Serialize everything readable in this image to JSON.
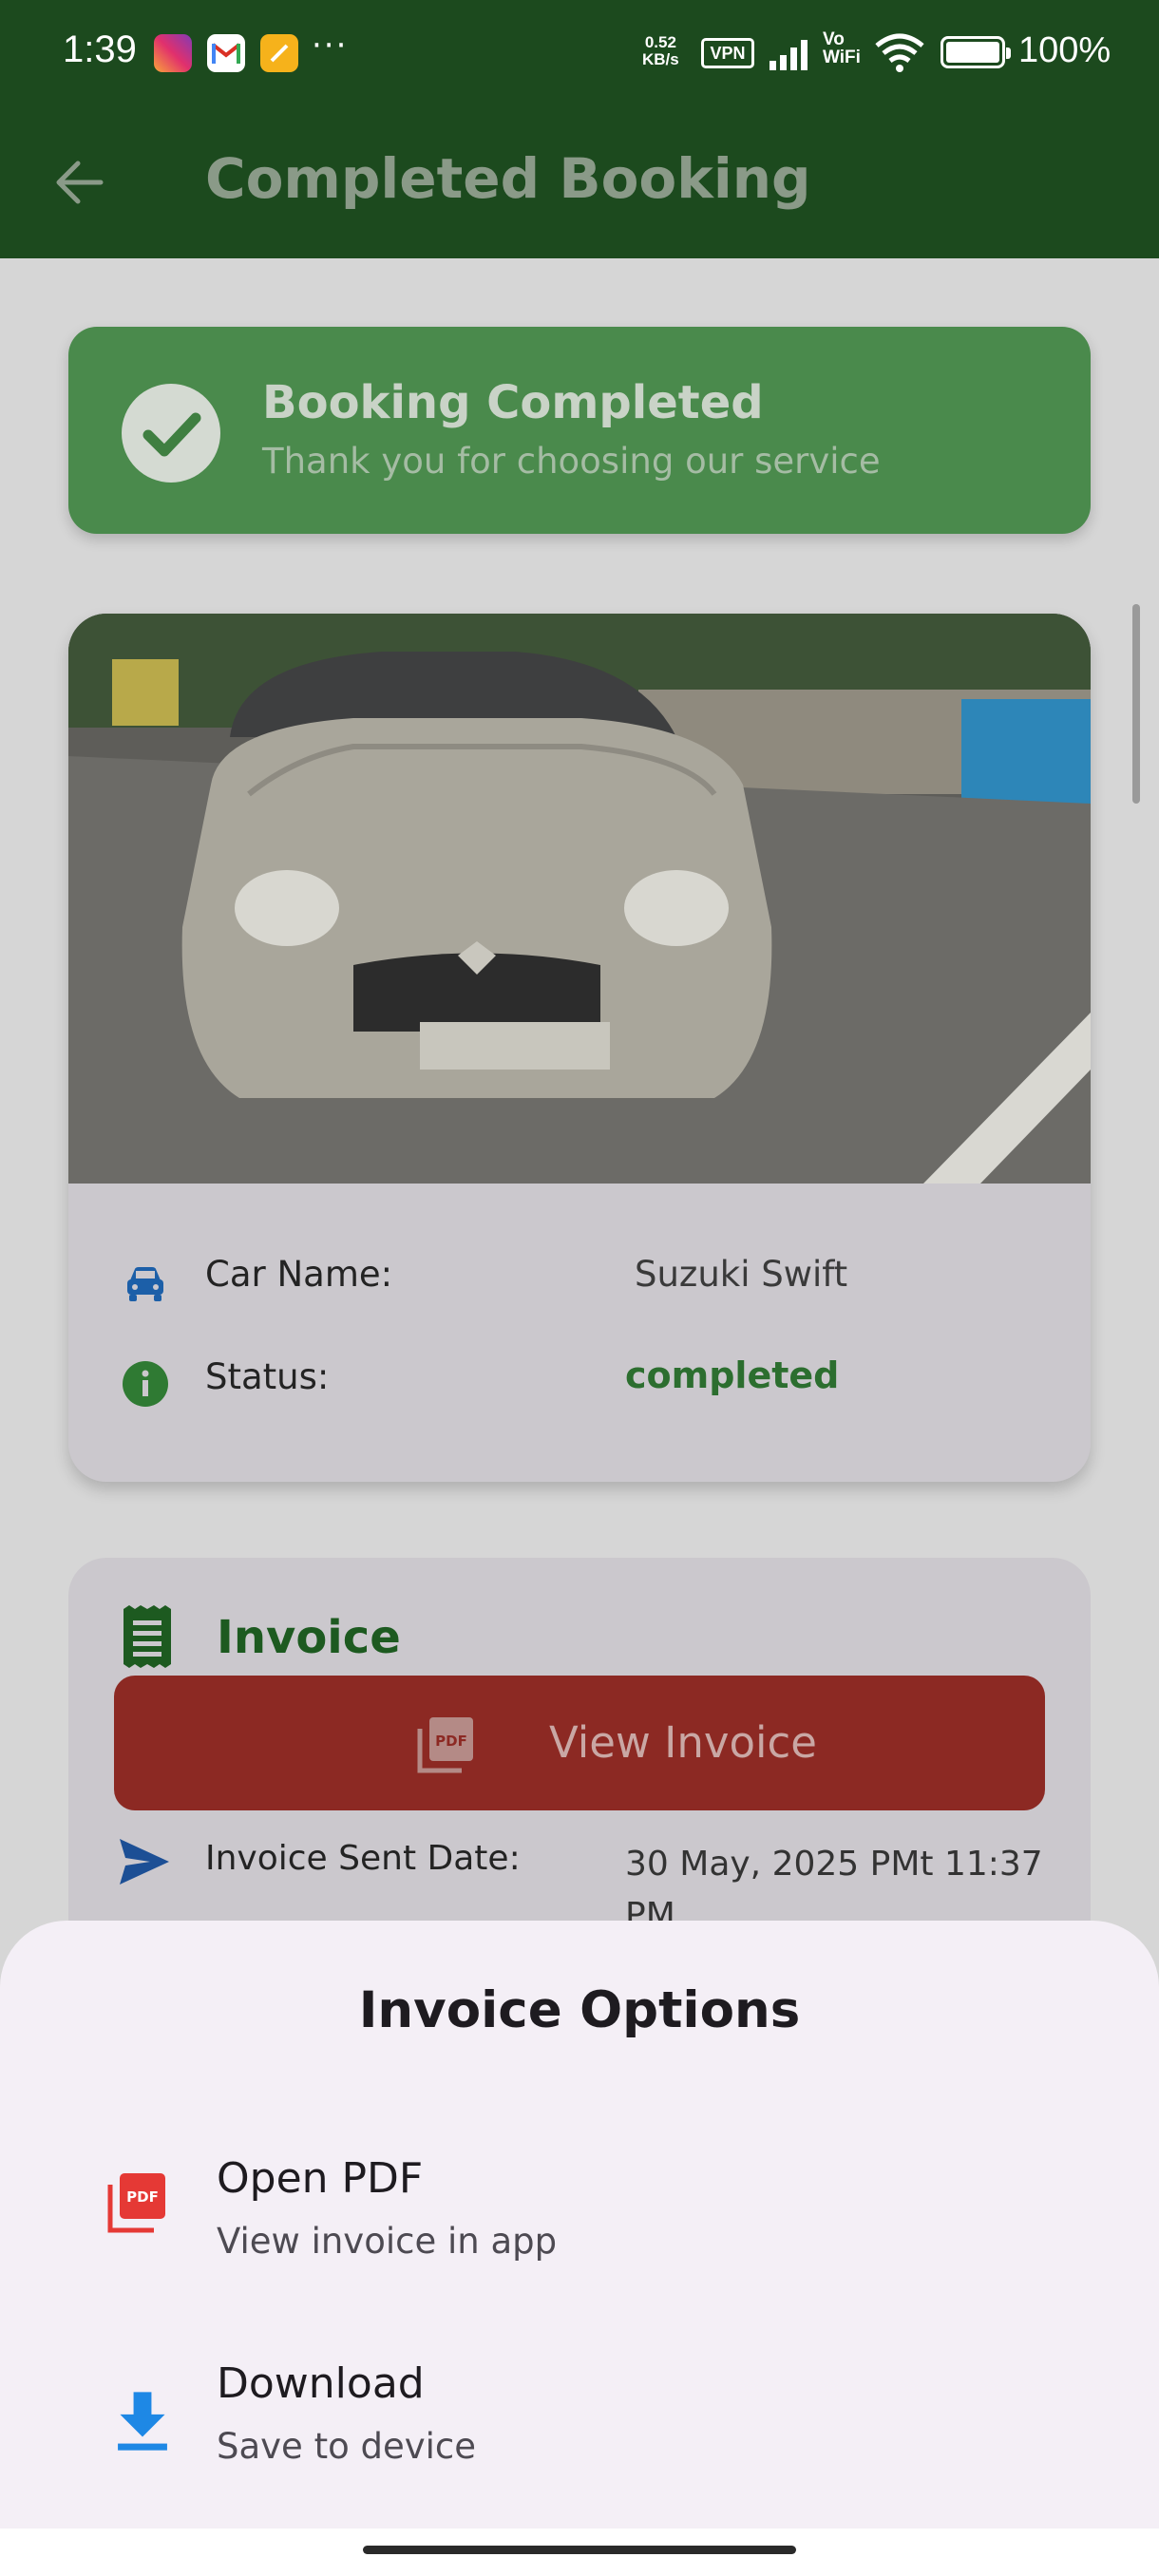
{
  "status_bar": {
    "time": "1:39",
    "more": "···",
    "net_speed_value": "0.52",
    "net_speed_unit": "KB/s",
    "vpn": "VPN",
    "vo": "Vo",
    "wifi_label": "WiFi",
    "battery": "100%",
    "battery_level": 1.0
  },
  "app_bar": {
    "title": "Completed Booking"
  },
  "banner": {
    "title": "Booking Completed",
    "subtitle": "Thank you for choosing our service"
  },
  "car_card": {
    "car_name_label": "Car Name:",
    "car_name_value": "Suzuki Swift",
    "status_label": "Status:",
    "status_value": "completed"
  },
  "invoice_card": {
    "title": "Invoice",
    "view_button_label": "View Invoice",
    "pdf_badge": "PDF",
    "sent_date_label": "Invoice Sent Date:",
    "sent_date_value": "30 May, 2025 PMt 11:37 PM"
  },
  "sheet": {
    "title": "Invoice Options",
    "options": [
      {
        "title": "Open PDF",
        "subtitle": "View invoice in app",
        "icon": "pdf-icon"
      },
      {
        "title": "Download",
        "subtitle": "Save to device",
        "icon": "download-icon"
      }
    ]
  },
  "colors": {
    "app_bar": "#1c4a1e",
    "banner": "#4a8a4c",
    "status_completed": "#2c6e2f",
    "view_invoice_button": "#8c2923",
    "sheet_background": "#f4eff6",
    "pdf_red": "#e53935",
    "download_blue": "#1e88e5"
  }
}
